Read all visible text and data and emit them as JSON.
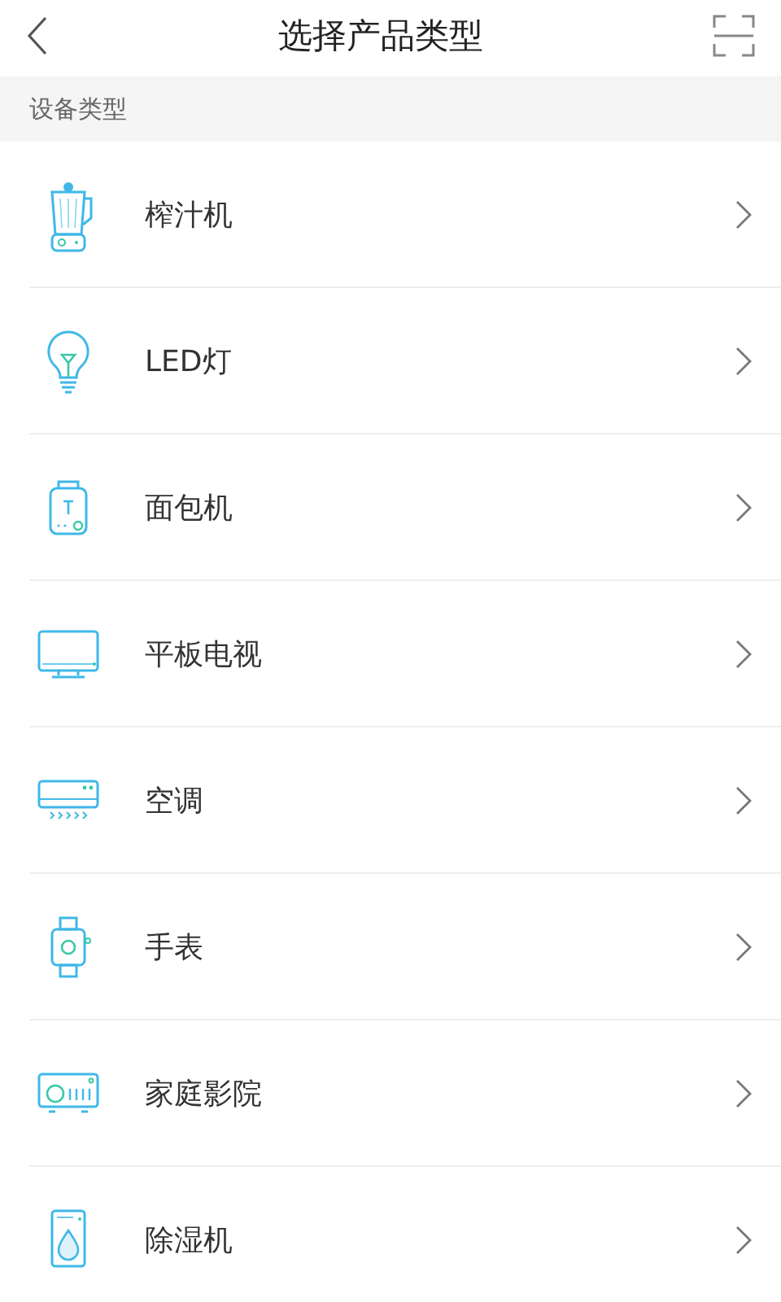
{
  "header": {
    "title": "选择产品类型"
  },
  "section": {
    "label": "设备类型"
  },
  "items": [
    {
      "kind": "juicer",
      "label": "榨汁机"
    },
    {
      "kind": "bulb",
      "label": "LED灯"
    },
    {
      "kind": "breadmaker",
      "label": "面包机"
    },
    {
      "kind": "tv",
      "label": "平板电视"
    },
    {
      "kind": "aircon",
      "label": "空调"
    },
    {
      "kind": "watch",
      "label": "手表"
    },
    {
      "kind": "theater",
      "label": "家庭影院"
    },
    {
      "kind": "dehumidifier",
      "label": "除湿机"
    }
  ]
}
